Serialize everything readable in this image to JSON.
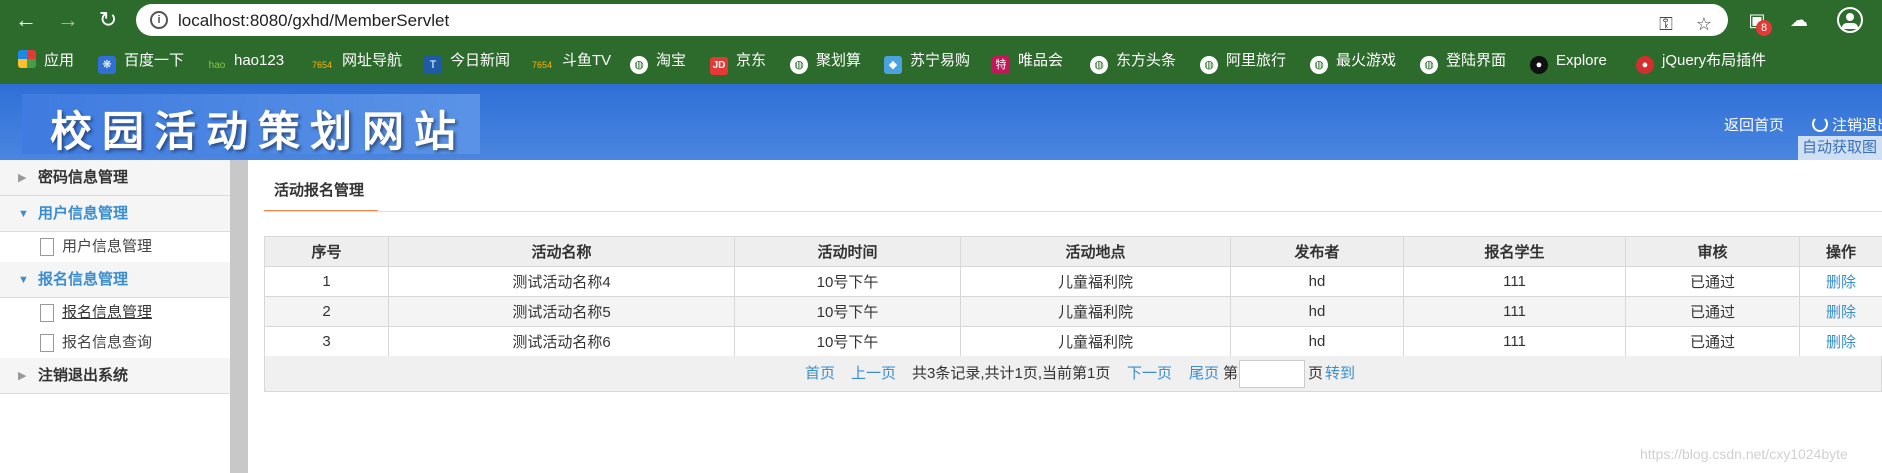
{
  "browser": {
    "url": "localhost:8080/gxhd/MemberServlet",
    "badge_count": "8",
    "bookmarks": [
      "应用",
      "百度一下",
      "hao123",
      "网址导航",
      "今日新闻",
      "斗鱼TV",
      "淘宝",
      "京东",
      "聚划算",
      "苏宁易购",
      "唯品会",
      "东方头条",
      "阿里旅行",
      "最火游戏",
      "登陆界面",
      "Explore",
      "jQuery布局插件"
    ],
    "bookmark_icons": {
      "hao123": "hao",
      "douyu": "7654",
      "jd": "JD",
      "vip": "特",
      "daohang": "7654"
    }
  },
  "header": {
    "logo_text": "校园活动策划网站",
    "home_link": "返回首页",
    "logout_link": "注销退出",
    "auto_button": "自动获取图"
  },
  "sidebar": {
    "groups": [
      {
        "label": "密码信息管理"
      },
      {
        "label": "用户信息管理",
        "items": [
          "用户信息管理"
        ]
      },
      {
        "label": "报名信息管理",
        "items": [
          "报名信息管理",
          "报名信息查询"
        ]
      },
      {
        "label": "注销退出系统"
      }
    ]
  },
  "main": {
    "tab_title": "活动报名管理",
    "columns": [
      "序号",
      "活动名称",
      "活动时间",
      "活动地点",
      "发布者",
      "报名学生",
      "审核",
      "操作"
    ],
    "rows": [
      [
        "1",
        "测试活动名称4",
        "10号下午",
        "儿童福利院",
        "hd",
        "111",
        "已通过",
        "删除"
      ],
      [
        "2",
        "测试活动名称5",
        "10号下午",
        "儿童福利院",
        "hd",
        "111",
        "已通过",
        "删除"
      ],
      [
        "3",
        "测试活动名称6",
        "10号下午",
        "儿童福利院",
        "hd",
        "111",
        "已通过",
        "删除"
      ]
    ],
    "pager": {
      "first": "首页",
      "prev": "上一页",
      "info": "共3条记录,共计1页,当前第1页",
      "next": "下一页",
      "last": "尾页",
      "page_prefix": "第",
      "page_suffix": "页",
      "goto": "转到"
    }
  },
  "watermark": "https://blog.csdn.net/cxy1024byte",
  "colors": {
    "chrome": "#2d6b2d",
    "header": "#3a7be0",
    "link": "#3a8ed0",
    "tab_accent": "#e8884a"
  }
}
